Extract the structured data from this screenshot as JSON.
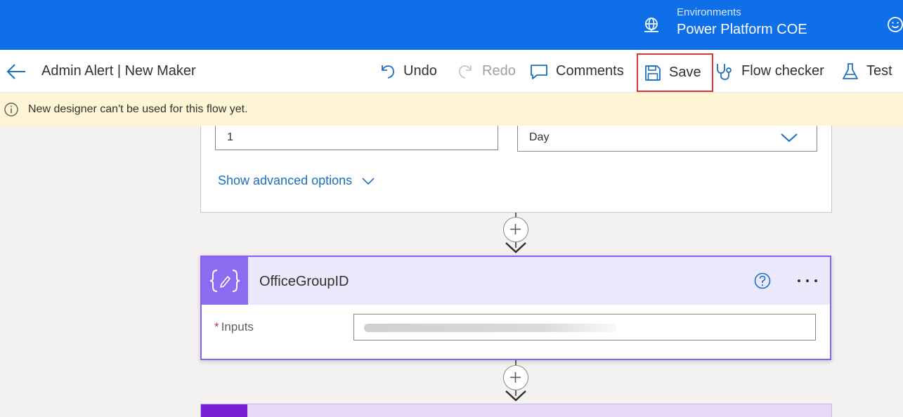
{
  "header": {
    "environments_label": "Environments",
    "environment_name": "Power Platform COE",
    "brand_color": "#0f6fe8"
  },
  "commandbar": {
    "flow_title": "Admin Alert | New Maker",
    "undo_label": "Undo",
    "redo_label": "Redo",
    "comments_label": "Comments",
    "save_label": "Save",
    "flow_checker_label": "Flow checker",
    "test_label": "Test"
  },
  "infobar": {
    "message": "New designer can't be used for this flow yet."
  },
  "recurrence_card": {
    "interval_value": "1",
    "frequency_value": "Day",
    "advanced_options_label": "Show advanced options"
  },
  "compose_card": {
    "title": "OfficeGroupID",
    "inputs_label": "Inputs",
    "required_marker": "*",
    "accent_color": "#8661f4"
  },
  "icons": {
    "back": "back-arrow-icon",
    "environment": "globe-icon",
    "feedback": "smiley-icon",
    "undo": "undo-icon",
    "redo": "redo-icon",
    "comments": "comment-icon",
    "save": "floppy-disk-icon",
    "checker": "stethoscope-icon",
    "test": "flask-icon",
    "info": "info-icon",
    "compose": "curly-braces-icon",
    "help": "question-icon",
    "more": "ellipsis-icon"
  }
}
